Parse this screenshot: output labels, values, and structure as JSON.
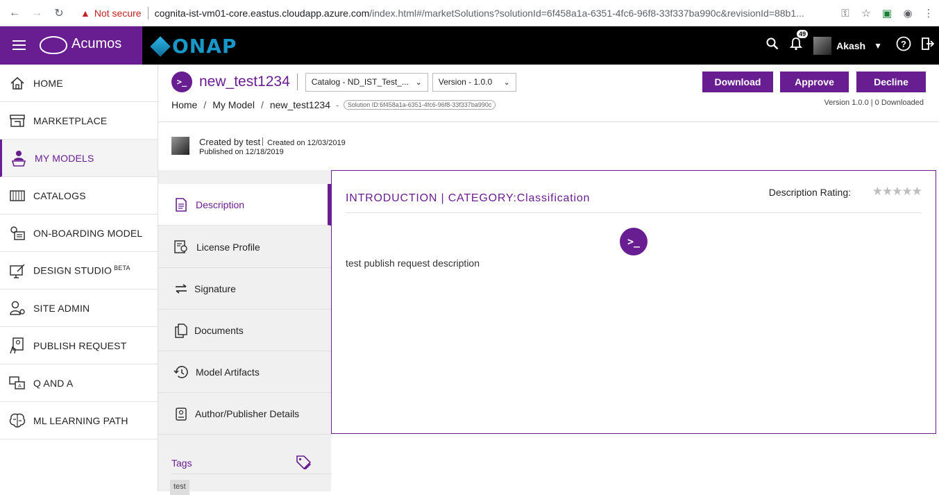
{
  "browser": {
    "security_label": "Not secure",
    "url_host": "cognita-ist-vm01-core.eastus.cloudapp.azure.com",
    "url_path": "/index.html#/marketSolutions?solutionId=6f458a1a-6351-4fc6-96f8-33f337ba990c&revisionId=88b1..."
  },
  "header": {
    "brand": "Acumos",
    "partner_logo": "ONAP",
    "notification_count": "49",
    "user_name": "Akash"
  },
  "sidebar": {
    "items": [
      {
        "label": "HOME",
        "icon": "home-icon"
      },
      {
        "label": "MARKETPLACE",
        "icon": "store-icon"
      },
      {
        "label": "MY MODELS",
        "icon": "user-laptop-icon",
        "active": true
      },
      {
        "label": "CATALOGS",
        "icon": "catalog-icon"
      },
      {
        "label": "ON-BOARDING MODEL",
        "icon": "onboarding-icon"
      },
      {
        "label": "DESIGN STUDIO",
        "icon": "design-icon",
        "sup": "BETA"
      },
      {
        "label": "SITE ADMIN",
        "icon": "admin-icon"
      },
      {
        "label": "PUBLISH REQUEST",
        "icon": "publish-icon"
      },
      {
        "label": "Q AND A",
        "icon": "qa-icon"
      },
      {
        "label": "ML LEARNING PATH",
        "icon": "brain-icon"
      }
    ]
  },
  "solution": {
    "name": "new_test1234",
    "catalog_select": "Catalog - ND_IST_Test_...",
    "version_select": "Version - 1.0.0",
    "buttons": {
      "download": "Download",
      "approve": "Approve",
      "decline": "Decline"
    },
    "breadcrumb": [
      "Home",
      "My Model",
      "new_test1234"
    ],
    "solution_id": "Solution ID:6f458a1a-6351-4fc6-96f8-33f337ba990c",
    "version_info": "Version 1.0.0 | 0 Downloaded",
    "created_by": "Created by test",
    "created_on": "Created on 12/03/2019",
    "published_on": "Published on 12/18/2019"
  },
  "tabs": [
    {
      "label": "Description",
      "active": true
    },
    {
      "label": "License Profile"
    },
    {
      "label": "Signature"
    },
    {
      "label": "Documents"
    },
    {
      "label": "Model Artifacts"
    },
    {
      "label": "Author/Publisher Details"
    }
  ],
  "tags": {
    "heading": "Tags",
    "items": [
      "test"
    ]
  },
  "description": {
    "heading": "INTRODUCTION | CATEGORY:Classification",
    "rating_label": "Description Rating:",
    "rating": 0,
    "rating_max": 5,
    "text": "test publish request description"
  },
  "colors": {
    "accent": "#681d90",
    "header_bg": "#000000"
  }
}
